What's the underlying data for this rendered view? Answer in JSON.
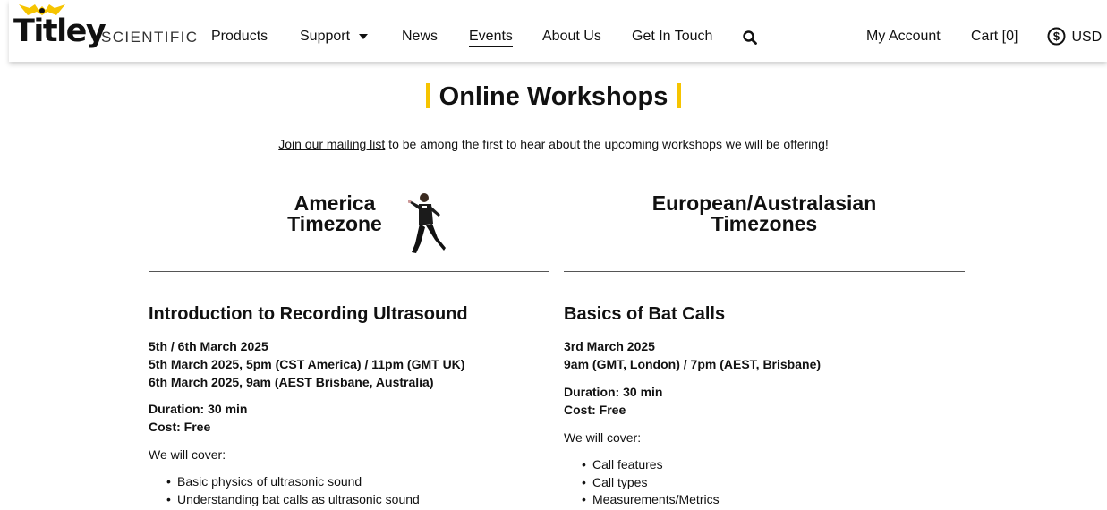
{
  "brand": {
    "word": "Titley",
    "sub": "SCIENTIFIC",
    "accent": "#f6c400"
  },
  "nav": {
    "products": "Products",
    "support": "Support",
    "news": "News",
    "events": "Events",
    "about": "About Us",
    "contact": "Get In Touch",
    "search_icon": "search-icon",
    "account": "My Account",
    "cart": "Cart [0]",
    "currency": "USD",
    "currency_icon": "dollar-circle-icon"
  },
  "main": {
    "title": "Online Workshops",
    "intro_link": "Join our mailing list",
    "intro_rest": " to be among the first to hear about the upcoming workshops we will be offering!",
    "left": {
      "tz_line1": "America",
      "tz_line2": "Timezone",
      "workshop": "Introduction to Recording Ultrasound",
      "dates": "5th / 6th March 2025",
      "time1": "5th March 2025, 5pm (CST America) / 11pm (GMT UK)",
      "time2": "6th March 2025, 9am (AEST Brisbane, Australia)",
      "duration": "Duration: 30 min",
      "cost": "Cost: Free",
      "cover": "We will cover:",
      "items": [
        "Basic physics of ultrasonic sound",
        "Understanding bat calls as ultrasonic sound"
      ]
    },
    "right": {
      "tz_line1": "European/Australasian",
      "tz_line2": "Timezones",
      "workshop": "Basics of Bat Calls",
      "dates": "3rd March 2025",
      "time1": "9am (GMT, London) / 7pm (AEST, Brisbane)",
      "duration": "Duration: 30 min",
      "cost": "Cost: Free",
      "cover": "We will cover:",
      "items": [
        "Call features",
        "Call types",
        "Measurements/Metrics"
      ]
    }
  }
}
